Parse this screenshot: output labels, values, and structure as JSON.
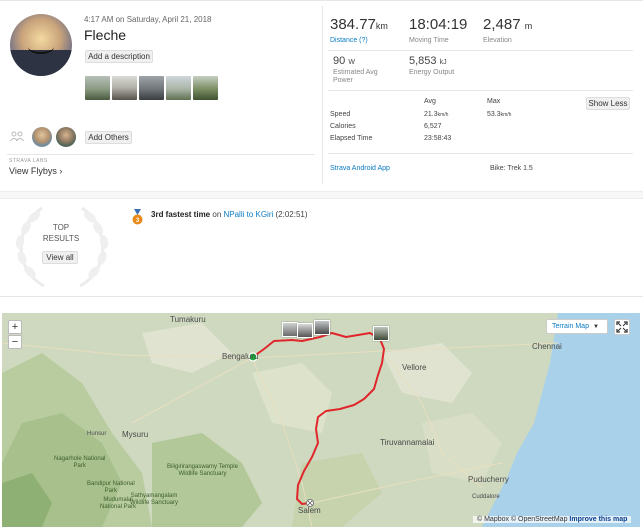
{
  "activity": {
    "date": "4:17 AM on Saturday, April 21, 2018",
    "title": "Fleche",
    "add_description": "Add a description",
    "add_others": "Add Others",
    "strava_labs": "STRAVA LABS",
    "view_flybys": "View Flybys ›"
  },
  "stats": {
    "distance": {
      "value": "384.77",
      "unit": "km",
      "label": "Distance (?)"
    },
    "moving_time": {
      "value": "18:04:19",
      "label": "Moving Time"
    },
    "elevation": {
      "value": "2,487",
      "unit": "m",
      "label": "Elevation"
    },
    "power": {
      "value": "90",
      "unit": "W",
      "label1": "Estimated Avg",
      "label2": "Power"
    },
    "energy": {
      "value": "5,853",
      "unit": "kJ",
      "label": "Energy Output"
    }
  },
  "table": {
    "col_avg": "Avg",
    "col_max": "Max",
    "show_less": "Show Less",
    "rows": [
      {
        "label": "Speed",
        "avg": "21.3",
        "avg_unit": "km/h",
        "max": "53.3",
        "max_unit": "km/h"
      },
      {
        "label": "Calories",
        "avg": "6,527",
        "avg_unit": "",
        "max": "",
        "max_unit": ""
      },
      {
        "label": "Elapsed Time",
        "avg": "23:58:43",
        "avg_unit": "",
        "max": "",
        "max_unit": ""
      }
    ],
    "device": "Strava Android App",
    "bike": "Bike: Trek 1.5"
  },
  "achievements": {
    "top_results_1": "TOP",
    "top_results_2": "RESULTS",
    "view_all": "View all",
    "medal_rank": "3",
    "text_rank": "3rd fastest time",
    "text_on": " on ",
    "segment": "NPalli to KGiri",
    "time": " (2:02:51)"
  },
  "map": {
    "zoom_in": "+",
    "zoom_out": "−",
    "layer": "Terrain Map",
    "attrib_1": "© Mapbox © OpenStreetMap ",
    "attrib_2": "Improve this map",
    "towns": {
      "tumakuru": "Tumakuru",
      "bengaluru": "Bengaluru",
      "chennai": "Chennai",
      "vellore": "Vellore",
      "mysuru": "Mysuru",
      "hunsur": "Hunsur",
      "tiruvannamalai": "Tiruvannamalai",
      "puducherry": "Puducherry",
      "cuddalore": "Cuddalore",
      "salem": "Salem"
    },
    "parks": {
      "nagarhole": [
        "Nagarhole National",
        "Park"
      ],
      "biligiri": [
        "Biligirirangaswamy Temple",
        "Wildlife Sanctuary"
      ],
      "bandipur": [
        "Bandipur National",
        "Park"
      ],
      "mudumalai": [
        "Mudumalai",
        "National Park"
      ],
      "sathyamangalam": [
        "Sathyamangalam",
        "Wildlife Sanctuary"
      ]
    }
  },
  "colors": {
    "link": "#0a7bc2",
    "route": "#e0262b",
    "start": "#1bae3b",
    "sea": "#a9d1ea",
    "medal": "#e88a1a"
  }
}
